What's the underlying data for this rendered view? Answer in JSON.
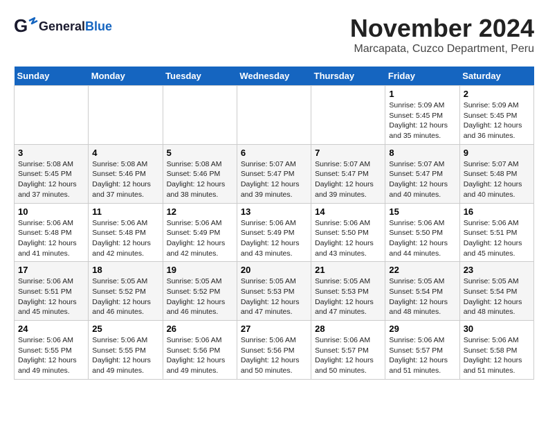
{
  "header": {
    "logo_general": "General",
    "logo_blue": "Blue",
    "title": "November 2024",
    "subtitle": "Marcapata, Cuzco Department, Peru"
  },
  "days_of_week": [
    "Sunday",
    "Monday",
    "Tuesday",
    "Wednesday",
    "Thursday",
    "Friday",
    "Saturday"
  ],
  "weeks": [
    {
      "days": [
        {
          "num": "",
          "info": ""
        },
        {
          "num": "",
          "info": ""
        },
        {
          "num": "",
          "info": ""
        },
        {
          "num": "",
          "info": ""
        },
        {
          "num": "",
          "info": ""
        },
        {
          "num": "1",
          "info": "Sunrise: 5:09 AM\nSunset: 5:45 PM\nDaylight: 12 hours\nand 35 minutes."
        },
        {
          "num": "2",
          "info": "Sunrise: 5:09 AM\nSunset: 5:45 PM\nDaylight: 12 hours\nand 36 minutes."
        }
      ]
    },
    {
      "days": [
        {
          "num": "3",
          "info": "Sunrise: 5:08 AM\nSunset: 5:45 PM\nDaylight: 12 hours\nand 37 minutes."
        },
        {
          "num": "4",
          "info": "Sunrise: 5:08 AM\nSunset: 5:46 PM\nDaylight: 12 hours\nand 37 minutes."
        },
        {
          "num": "5",
          "info": "Sunrise: 5:08 AM\nSunset: 5:46 PM\nDaylight: 12 hours\nand 38 minutes."
        },
        {
          "num": "6",
          "info": "Sunrise: 5:07 AM\nSunset: 5:47 PM\nDaylight: 12 hours\nand 39 minutes."
        },
        {
          "num": "7",
          "info": "Sunrise: 5:07 AM\nSunset: 5:47 PM\nDaylight: 12 hours\nand 39 minutes."
        },
        {
          "num": "8",
          "info": "Sunrise: 5:07 AM\nSunset: 5:47 PM\nDaylight: 12 hours\nand 40 minutes."
        },
        {
          "num": "9",
          "info": "Sunrise: 5:07 AM\nSunset: 5:48 PM\nDaylight: 12 hours\nand 40 minutes."
        }
      ]
    },
    {
      "days": [
        {
          "num": "10",
          "info": "Sunrise: 5:06 AM\nSunset: 5:48 PM\nDaylight: 12 hours\nand 41 minutes."
        },
        {
          "num": "11",
          "info": "Sunrise: 5:06 AM\nSunset: 5:48 PM\nDaylight: 12 hours\nand 42 minutes."
        },
        {
          "num": "12",
          "info": "Sunrise: 5:06 AM\nSunset: 5:49 PM\nDaylight: 12 hours\nand 42 minutes."
        },
        {
          "num": "13",
          "info": "Sunrise: 5:06 AM\nSunset: 5:49 PM\nDaylight: 12 hours\nand 43 minutes."
        },
        {
          "num": "14",
          "info": "Sunrise: 5:06 AM\nSunset: 5:50 PM\nDaylight: 12 hours\nand 43 minutes."
        },
        {
          "num": "15",
          "info": "Sunrise: 5:06 AM\nSunset: 5:50 PM\nDaylight: 12 hours\nand 44 minutes."
        },
        {
          "num": "16",
          "info": "Sunrise: 5:06 AM\nSunset: 5:51 PM\nDaylight: 12 hours\nand 45 minutes."
        }
      ]
    },
    {
      "days": [
        {
          "num": "17",
          "info": "Sunrise: 5:06 AM\nSunset: 5:51 PM\nDaylight: 12 hours\nand 45 minutes."
        },
        {
          "num": "18",
          "info": "Sunrise: 5:05 AM\nSunset: 5:52 PM\nDaylight: 12 hours\nand 46 minutes."
        },
        {
          "num": "19",
          "info": "Sunrise: 5:05 AM\nSunset: 5:52 PM\nDaylight: 12 hours\nand 46 minutes."
        },
        {
          "num": "20",
          "info": "Sunrise: 5:05 AM\nSunset: 5:53 PM\nDaylight: 12 hours\nand 47 minutes."
        },
        {
          "num": "21",
          "info": "Sunrise: 5:05 AM\nSunset: 5:53 PM\nDaylight: 12 hours\nand 47 minutes."
        },
        {
          "num": "22",
          "info": "Sunrise: 5:05 AM\nSunset: 5:54 PM\nDaylight: 12 hours\nand 48 minutes."
        },
        {
          "num": "23",
          "info": "Sunrise: 5:05 AM\nSunset: 5:54 PM\nDaylight: 12 hours\nand 48 minutes."
        }
      ]
    },
    {
      "days": [
        {
          "num": "24",
          "info": "Sunrise: 5:06 AM\nSunset: 5:55 PM\nDaylight: 12 hours\nand 49 minutes."
        },
        {
          "num": "25",
          "info": "Sunrise: 5:06 AM\nSunset: 5:55 PM\nDaylight: 12 hours\nand 49 minutes."
        },
        {
          "num": "26",
          "info": "Sunrise: 5:06 AM\nSunset: 5:56 PM\nDaylight: 12 hours\nand 49 minutes."
        },
        {
          "num": "27",
          "info": "Sunrise: 5:06 AM\nSunset: 5:56 PM\nDaylight: 12 hours\nand 50 minutes."
        },
        {
          "num": "28",
          "info": "Sunrise: 5:06 AM\nSunset: 5:57 PM\nDaylight: 12 hours\nand 50 minutes."
        },
        {
          "num": "29",
          "info": "Sunrise: 5:06 AM\nSunset: 5:57 PM\nDaylight: 12 hours\nand 51 minutes."
        },
        {
          "num": "30",
          "info": "Sunrise: 5:06 AM\nSunset: 5:58 PM\nDaylight: 12 hours\nand 51 minutes."
        }
      ]
    }
  ]
}
